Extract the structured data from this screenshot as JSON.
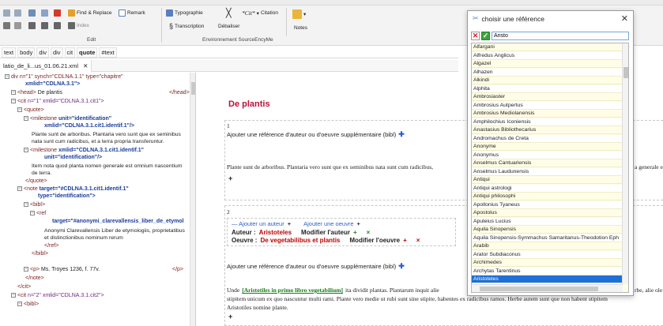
{
  "ribbon": {
    "find_replace": "Find & Replace",
    "remark": "Remark",
    "typographie": "Typographie",
    "citation_code": "*Cit*",
    "citation": "Citation",
    "transcription": "Transcription",
    "debaliser": "Débaliser",
    "notes": "Notes",
    "index": "Index",
    "edit_group": "Edit",
    "env_group": "Environnement SourceEncyMe"
  },
  "breadcrumb": [
    "text",
    "body",
    "div",
    "div",
    "cit",
    "quote",
    "#text"
  ],
  "file_tab": {
    "label": "latio_de_li...us_01.06.21.xml",
    "close": "✕"
  },
  "tree": {
    "line0": "div n=\"1\" synch=\"CDLNA.1.1\" type=\"chapitre\"",
    "line0b": "xmlid=\"CDLNA.3.1\">",
    "head_open": "<head>",
    "head_text": "De plantis",
    "head_close": "</head>",
    "cit1_tag": "<cit",
    "cit1_attrs": "n=\"1\" xmlid=\"CDLNA.3.1.cit1\">",
    "quote_open": "<quote>",
    "milestone1_tag": "<milestone",
    "milestone1_attr": "unit=\"identification\"",
    "milestone1_attr2": "xmlid=\"CDLNA.3.1.cit1.identif.1\"/>",
    "quote_text1": "Plante sunt de arboribus. Plantaria vero sunt que ex seminibus nata sunt cum radicibus, et a terra propria transferuntur.",
    "milestone2_tag": "<milestone",
    "milestone2_attr": "xmlid=\"CDLNA.3.1.cit1.identif.1\"",
    "milestone2_attr2": "unit=\"identification\"/>",
    "quote_text2": "Item nota quod planta nomen generale est omnium nascentium de terra.",
    "quote_close": "</quote>",
    "note_tag": "<note",
    "note_attrs": "target=\"#CDLNA.3.1.cit1.identif.1\"",
    "note_attrs2": "type=\"identification\">",
    "bibl_open": "<bibl>",
    "ref_open": "<ref",
    "ref_attrs": "target=\"#anonymi_clarevallensis_liber_de_etymol",
    "ref_text": "Anonymi Clarevallensis Liber de etymologiis, proprietatibus et distinctionibus nominum rerum",
    "ref_close": "</ref>",
    "bibl_close": "</bibl>",
    "p_open": "<p>",
    "p_text": "Ms. Troyes 1236, f. 77v.",
    "p_close": "</p>",
    "note_close": "</note>",
    "cit_close": "</cit>",
    "cit2": "<cit",
    "cit2_attrs": "n=\"2\" xmlid=\"CDLNA.3.1.cit2\">",
    "bibl2": "<bibl>"
  },
  "editor": {
    "title": "De plantis",
    "block1_num": "1",
    "add_ref_text": "Ajouter une référence d'auteur ou d'oeuvre supplémentaire (bibl)",
    "block1_quote": "Plante sunt de arboribus. Plantaria vero sunt que ex seminibus nata sunt cum radicibus,",
    "block1_overflow": "a generale e",
    "plus": "+",
    "block2_num": "2",
    "add_author": "— Ajouter un auteur",
    "add_work": "Ajouter une oeuvre",
    "author_label": "Auteur :",
    "author_value": "Aristoteles",
    "modify_author": "Modifier l'auteur",
    "x_mark": "×",
    "work_label": "Oeuvre :",
    "work_value": "De vegetabilibus et plantis",
    "modify_work": "Modifier l'oeuvre",
    "add_ref_text2": "Ajouter une référence d'auteur ou d'oeuvre supplémentaire (bibl)",
    "unde_prefix": "Unde",
    "unde_link": "[Aristotiles in primo libro vegetabilium]",
    "unde_rest": "ita dividit plantas. Plantarum inquit alie",
    "overflow_right": "rbe, alie ole",
    "line2": "stipitem unicum ex quo nascuntur multi rami. Plante vero medie ut rubi sunt sine stipite, habentes ex radicibus ramos. Herbe autem sunt que non habent stipitem",
    "line3": "Aristotiles nomine plante."
  },
  "dialog": {
    "title": "choisir une référence",
    "close": "✕",
    "search_value": "Aristo",
    "items": [
      "Alfargani",
      "Alfredus Anglicus",
      "Algazel",
      "Alhazen",
      "Alkindi",
      "Alphita",
      "Ambrosiaster",
      "Ambrosius Autpertus",
      "Ambrosius Mediolanensis",
      "Amphilochius Iconiensis",
      "Anastasius Bibliothecarius",
      "Andromachus de Creta",
      "Anonyme",
      "Anonymus",
      "Anselmus Cantuariensis",
      "Anselmus Laudunensis",
      "Antiqui",
      "Antiqui astrologi",
      "Antiqui philosophi",
      "Apollonius Tyaneus",
      "Apostolus",
      "Apuleius Lucius",
      "Aquila Sinopensis",
      "Aquila Sinopensis-Symmachus Samaritanus-Theodotion Eph",
      "Arabib",
      "Arator Subdiaconus",
      "Archimedes",
      "Archytas Tarentinus",
      "Aristoteles"
    ],
    "selected_index": 28
  },
  "colors": {
    "accent_blue": "#1e6fd8",
    "tag_red": "#7a1f1f",
    "list_yellow": "#fffde6",
    "action_red": "#c00000",
    "action_green": "#1a8a1a"
  }
}
